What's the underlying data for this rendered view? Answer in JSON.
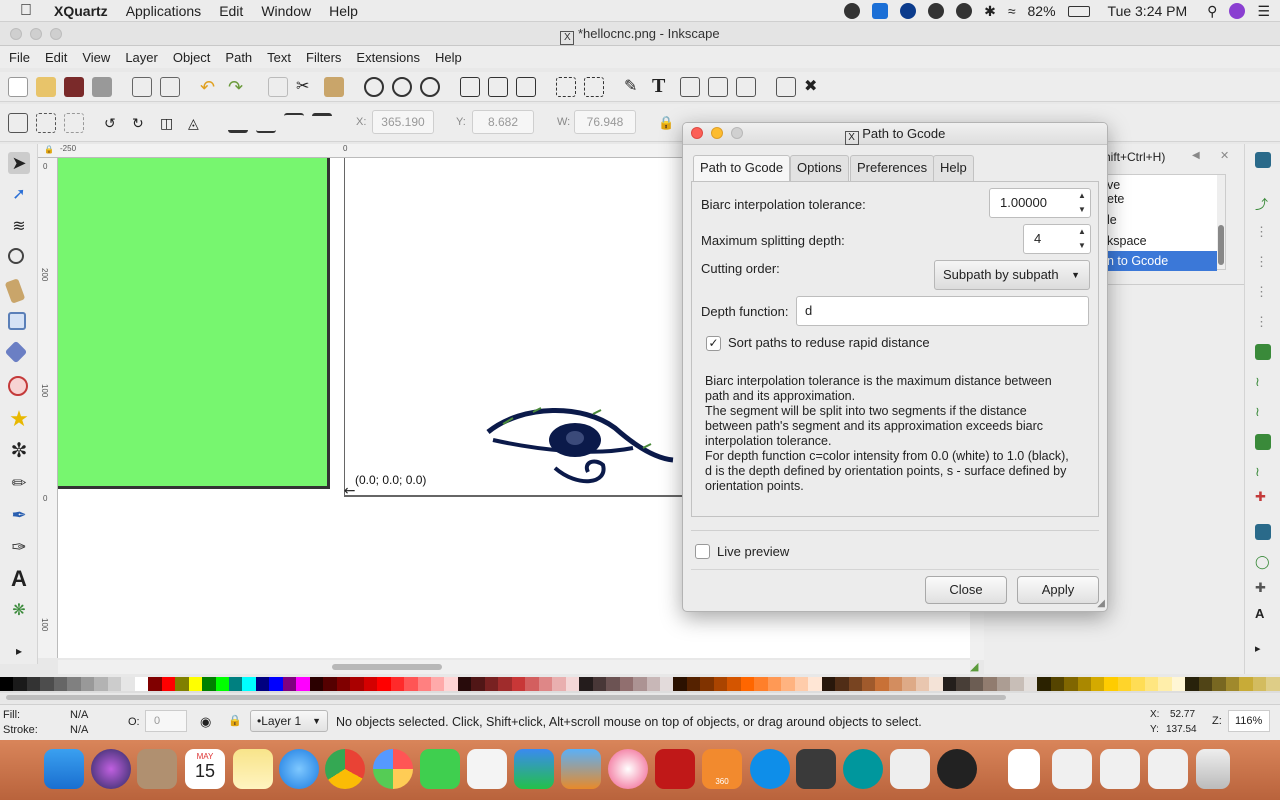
{
  "macos_menubar": {
    "app_name": "XQuartz",
    "items": [
      "Applications",
      "Edit",
      "Window",
      "Help"
    ],
    "battery": "82%",
    "clock": "Tue 3:24 PM"
  },
  "window": {
    "title": "*hellocnc.png - Inkscape"
  },
  "app_menu": [
    "File",
    "Edit",
    "View",
    "Layer",
    "Object",
    "Path",
    "Text",
    "Filters",
    "Extensions",
    "Help"
  ],
  "controls": {
    "x_label": "X:",
    "x_value": "365.190",
    "y_label": "Y:",
    "y_value": "8.682",
    "w_label": "W:",
    "w_value": "76.948"
  },
  "canvas": {
    "origin_label": "(0.0; 0.0; 0.0)",
    "ruler_top": [
      "-250",
      "0"
    ],
    "ruler_left": [
      "0",
      "200",
      "100",
      "0",
      "100"
    ]
  },
  "right_panel": {
    "header_fragment": "hift+Ctrl+H)",
    "items": [
      "ve",
      "ete",
      "le",
      "kspace",
      "n to Gcode"
    ],
    "selected_index": 4
  },
  "dialog": {
    "title": "Path to Gcode",
    "tabs": [
      "Path to Gcode",
      "Options",
      "Preferences",
      "Help"
    ],
    "active_tab": "Path to Gcode",
    "biarc_label": "Biarc interpolation tolerance:",
    "biarc_value": "1.00000",
    "depth_split_label": "Maximum splitting depth:",
    "depth_split_value": "4",
    "cutting_order_label": "Cutting order:",
    "cutting_order_value": "Subpath by subpath",
    "depth_function_label": "Depth function:",
    "depth_function_value": "d",
    "sort_paths_label": "Sort paths to reduse rapid distance",
    "sort_paths_checked": true,
    "help_lines": [
      "Biarc interpolation tolerance is the maximum distance between path and its approximation.",
      "The segment will be split into two segments if the distance between path's segment and its approximation exceeds biarc interpolation tolerance.",
      "For depth function c=color intensity from 0.0 (white) to 1.0 (black), d is the depth defined by orientation points, s - surface defined by orientation points."
    ],
    "live_preview_label": "Live preview",
    "live_preview_checked": false,
    "close_label": "Close",
    "apply_label": "Apply"
  },
  "statusbar": {
    "fill_label": "Fill:",
    "fill_value": "N/A",
    "stroke_label": "Stroke:",
    "stroke_value": "N/A",
    "opacity_label": "O:",
    "opacity_value": "0",
    "layer": "•Layer 1",
    "message": "No objects selected. Click, Shift+click, Alt+scroll mouse on top of objects, or drag around objects to select.",
    "coord_x_label": "X:",
    "coord_x": "52.77",
    "coord_y_label": "Y:",
    "coord_y": "137.54",
    "zoom_label": "Z:",
    "zoom": "116%"
  },
  "dock": {
    "calendar_month": "MAY",
    "calendar_day": "15",
    "fusion_label": "360"
  },
  "colors": {
    "green_rect": "#77f66f",
    "selection_blue": "#3b78d8",
    "dialog_bg": "#ececec"
  }
}
